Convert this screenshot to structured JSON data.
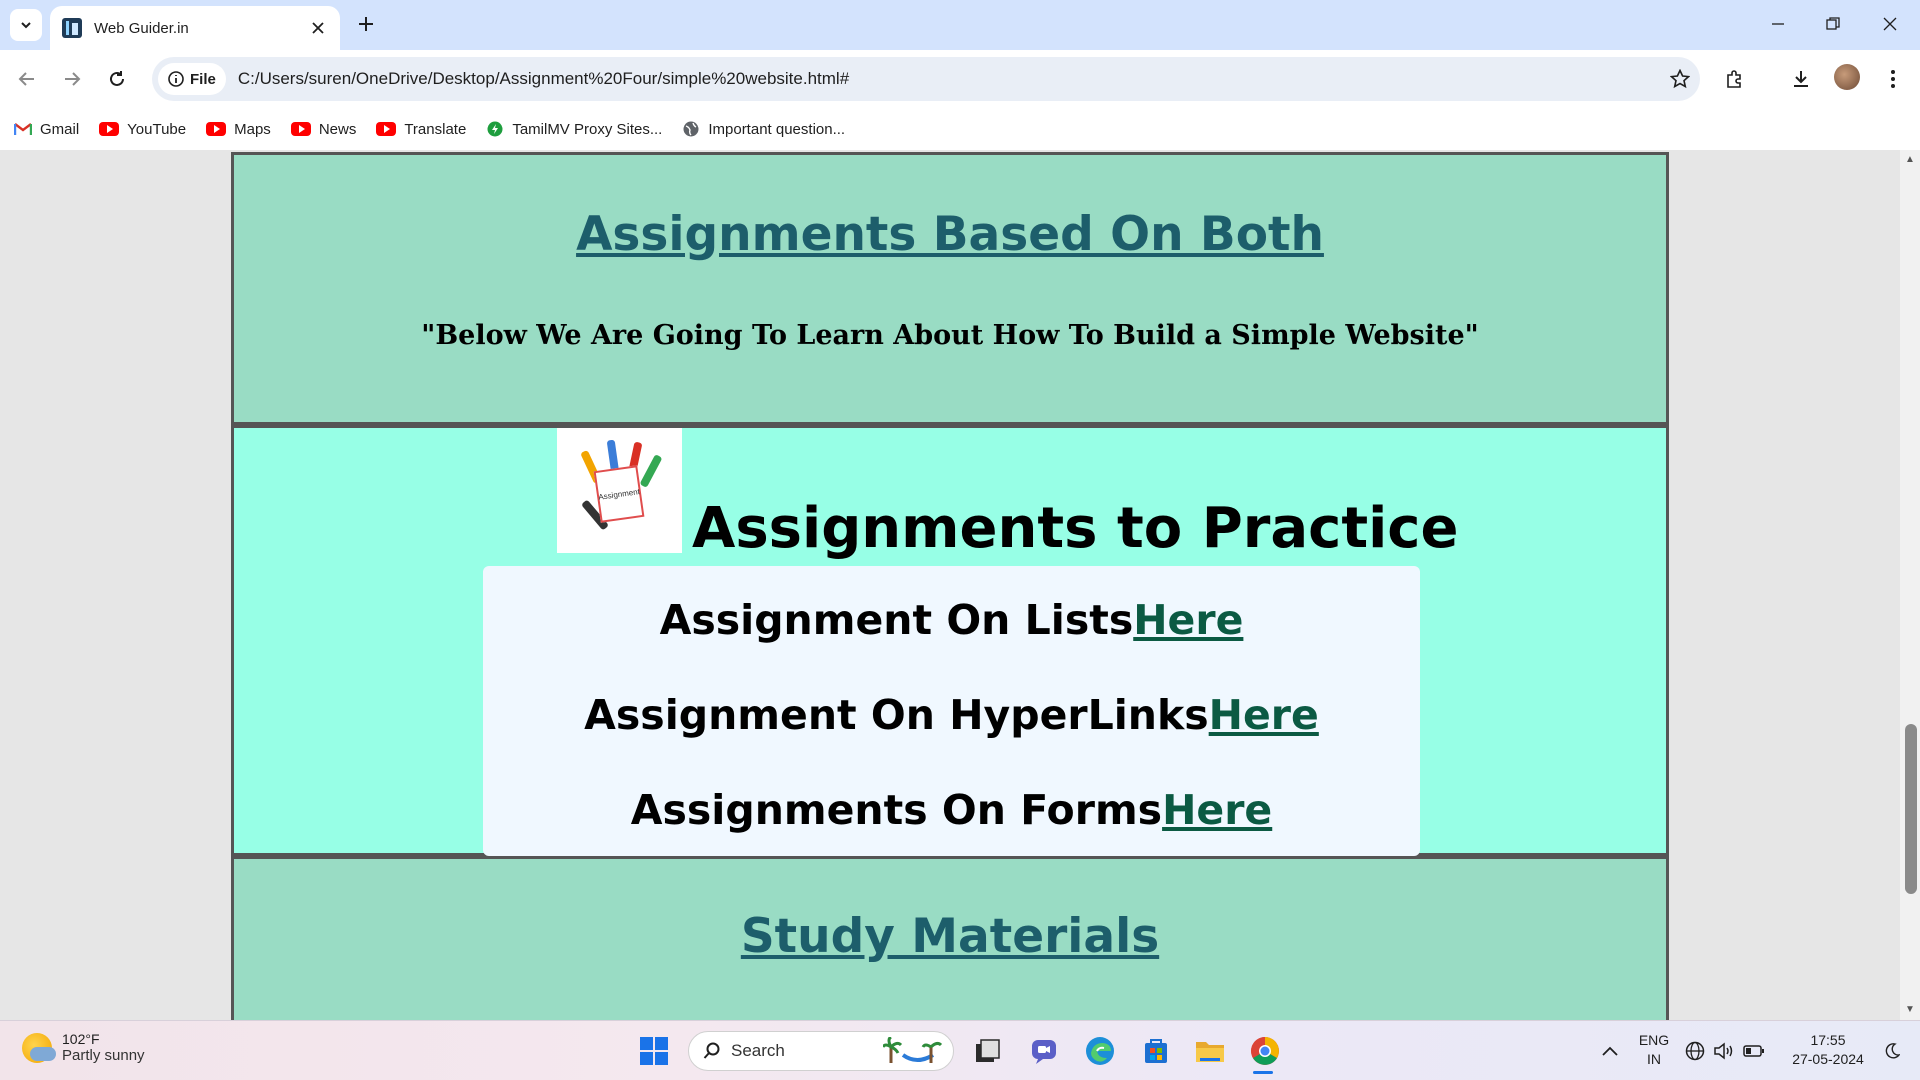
{
  "browser": {
    "tab_title": "Web Guider.in",
    "url_chip": "File",
    "url": "C:/Users/suren/OneDrive/Desktop/Assignment%20Four/simple%20website.html#"
  },
  "bookmarks": [
    {
      "label": "Gmail",
      "icon": "gmail-icon"
    },
    {
      "label": "YouTube",
      "icon": "youtube-icon"
    },
    {
      "label": "Maps",
      "icon": "youtube-icon"
    },
    {
      "label": "News",
      "icon": "youtube-icon"
    },
    {
      "label": "Translate",
      "icon": "youtube-icon"
    },
    {
      "label": "TamilMV Proxy Sites...",
      "icon": "tamilmv-icon"
    },
    {
      "label": "Important question...",
      "icon": "globe-icon"
    }
  ],
  "page": {
    "section1": {
      "heading": "Assignments Based On Both",
      "quote": "\"Below We Are Going To Learn About How To Build a Simple Website\""
    },
    "section2": {
      "title": "Assignments to Practice",
      "image_label": "Assignment",
      "rows": [
        {
          "text": "Assignment On Lists",
          "link": "Here"
        },
        {
          "text": "Assignment On HyperLinks",
          "link": "Here"
        },
        {
          "text": "Assignments On Forms",
          "link": "Here"
        }
      ]
    },
    "section3": {
      "heading": "Study Materials"
    }
  },
  "taskbar": {
    "temperature": "102°F",
    "weather": "Partly sunny",
    "search_placeholder": "Search",
    "lang_top": "ENG",
    "lang_bottom": "IN",
    "time": "17:55",
    "date": "27-05-2024"
  },
  "colors": {
    "section_bg": "#99dcc4",
    "practice_bg": "#97ffe6",
    "link_heading": "#1d5e6b",
    "link_here": "#0b5a43"
  }
}
